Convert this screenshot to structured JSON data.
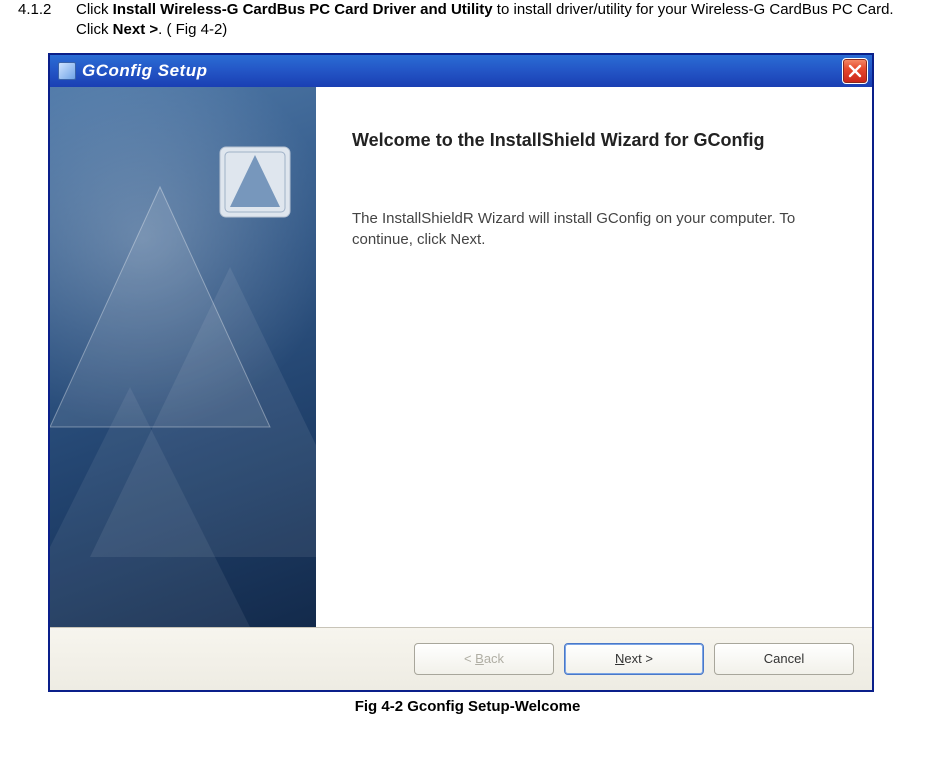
{
  "instruction": {
    "step_number": "4.1.2",
    "text_pre": "Click ",
    "bold1": "Install Wireless-G CardBus PC Card Driver and Utility",
    "text_mid": " to install driver/utility for your Wireless-G CardBus PC Card. Click ",
    "bold2": "Next >",
    "text_post": ". ( Fig 4-2)"
  },
  "window": {
    "title": "GConfig Setup",
    "heading": "Welcome to the InstallShield Wizard for GConfig",
    "body_text": "The InstallShieldR Wizard will install GConfig on your computer.  To continue, click Next.",
    "buttons": {
      "back": "< Back",
      "next": "Next >",
      "cancel": "Cancel"
    },
    "back_access": "B",
    "next_access": "N"
  },
  "caption": "Fig 4-2 Gconfig Setup-Welcome"
}
